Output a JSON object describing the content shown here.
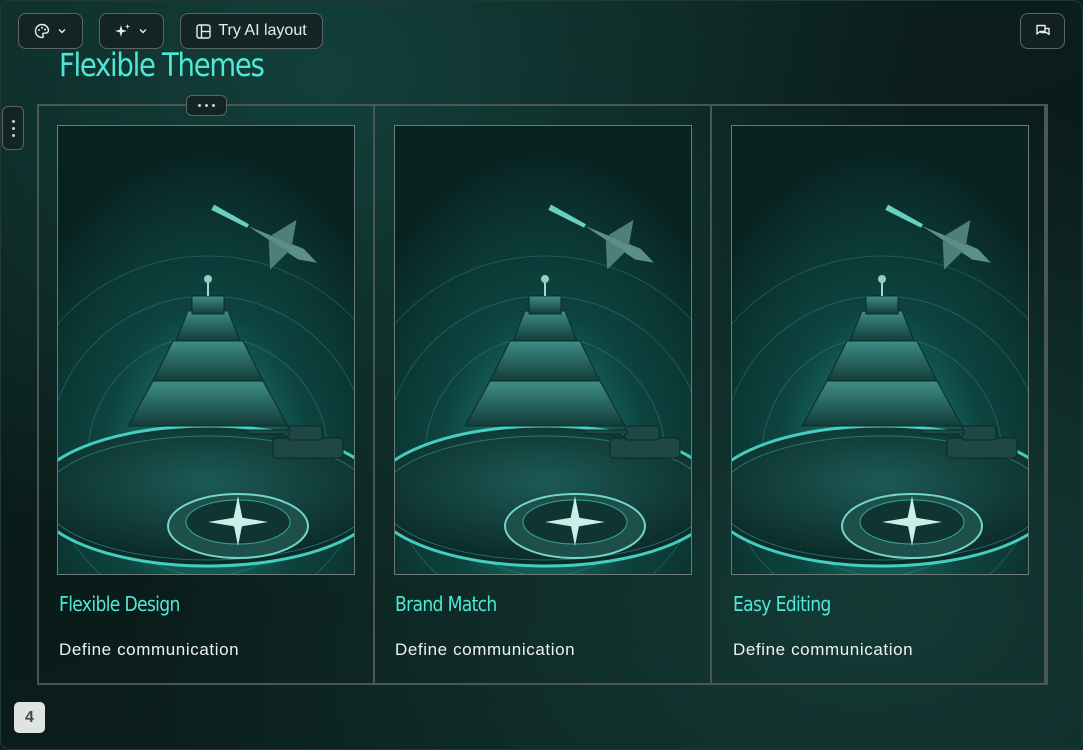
{
  "toolbar": {
    "theme_icon": "palette-icon",
    "ai_icon": "sparkle-icon",
    "layout_icon": "layout-icon",
    "layout_label": "Try AI layout",
    "comment_icon": "comment-icon"
  },
  "slide": {
    "title": "Flexible Themes",
    "page_number": "4",
    "cards": [
      {
        "title": "Flexible Design",
        "description": "Define communication",
        "image": "military-fortress-illustration"
      },
      {
        "title": "Brand Match",
        "description": "Define communication",
        "image": "military-fortress-illustration"
      },
      {
        "title": "Easy Editing",
        "description": "Define communication",
        "image": "military-fortress-illustration"
      }
    ]
  },
  "colors": {
    "accent": "#4ee8d6",
    "background": "#0d2421",
    "border": "#4a5755"
  }
}
